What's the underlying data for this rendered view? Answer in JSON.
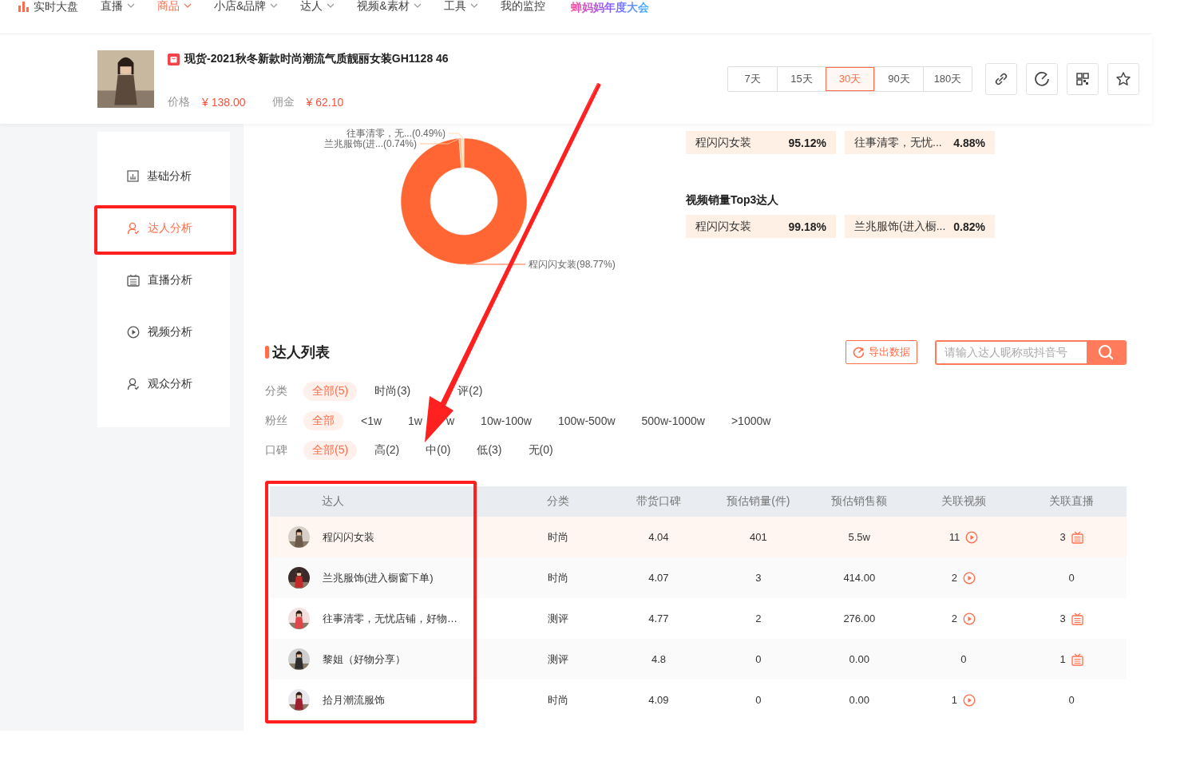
{
  "top_nav": {
    "items": [
      {
        "label": "实时大盘",
        "selected": false,
        "dropdown": false
      },
      {
        "label": "直播",
        "selected": false,
        "dropdown": true
      },
      {
        "label": "商品",
        "selected": true,
        "dropdown": true
      },
      {
        "label": "小店&品牌",
        "selected": false,
        "dropdown": true
      },
      {
        "label": "达人",
        "selected": false,
        "dropdown": true
      },
      {
        "label": "视频&素材",
        "selected": false,
        "dropdown": true
      },
      {
        "label": "工具",
        "selected": false,
        "dropdown": true
      },
      {
        "label": "我的监控",
        "selected": false,
        "dropdown": false
      }
    ],
    "promo": "蝉妈妈年度大会"
  },
  "product": {
    "title": "现货-2021秋冬新款时尚潮流气质靓丽女装GH1128 46",
    "price_label": "价格",
    "price": "¥ 138.00",
    "commission_label": "佣金",
    "commission": "¥ 62.10",
    "ranges": [
      {
        "label": "7天",
        "selected": false
      },
      {
        "label": "15天",
        "selected": false
      },
      {
        "label": "30天",
        "selected": true
      },
      {
        "label": "90天",
        "selected": false
      },
      {
        "label": "180天",
        "selected": false
      }
    ]
  },
  "sidebar": {
    "items": [
      {
        "label": "基础分析",
        "selected": false
      },
      {
        "label": "达人分析",
        "selected": true
      },
      {
        "label": "直播分析",
        "selected": false
      },
      {
        "label": "视频分析",
        "selected": false
      },
      {
        "label": "观众分析",
        "selected": false
      }
    ]
  },
  "share": {
    "chart_data": {
      "type": "donut",
      "categories": [
        "程闪闪女装(98.77%)",
        "兰兆服饰(进...(0.74%)",
        "往事清零，无...(0.49%)"
      ],
      "values": [
        98.77,
        0.74,
        0.49
      ]
    },
    "groups": [
      {
        "items": [
          {
            "name": "程闪闪女装",
            "share": "95.12%"
          },
          {
            "name": "往事清零，无忧...",
            "share": "4.88%"
          }
        ]
      },
      {
        "title": "视频销量Top3达人",
        "items": [
          {
            "name": "程闪闪女装",
            "share": "99.18%"
          },
          {
            "name": "兰兆服饰(进入橱...",
            "share": "0.82%"
          }
        ]
      }
    ]
  },
  "creator_list": {
    "title": "达人列表",
    "export": "导出数据",
    "search": {
      "placeholder": "请输入达人昵称或抖音号"
    },
    "filters": [
      {
        "label": "分类",
        "options": [
          {
            "label": "全部(5)",
            "selected": true,
            "kind": "plain"
          },
          {
            "label": "时尚(3)",
            "selected": false,
            "kind": "plain"
          },
          {
            "label": "评(2)",
            "selected": false,
            "kind": "covered"
          }
        ]
      },
      {
        "label": "粉丝",
        "options": [
          {
            "label": "全部",
            "selected": true,
            "kind": "plain"
          },
          {
            "label": "<1w",
            "selected": false,
            "kind": "plain"
          },
          {
            "label": "1w",
            "tail": "w",
            "selected": false,
            "kind": "split"
          },
          {
            "label": "10w-100w",
            "selected": false,
            "kind": "plain"
          },
          {
            "label": "100w-500w",
            "selected": false,
            "kind": "plain"
          },
          {
            "label": "500w-1000w",
            "selected": false,
            "kind": "plain"
          },
          {
            "label": ">1000w",
            "selected": false,
            "kind": "plain"
          }
        ]
      },
      {
        "label": "口碑",
        "options": [
          {
            "label": "全部(5)",
            "selected": true,
            "kind": "plain"
          },
          {
            "label": "高(2)",
            "selected": false,
            "kind": "plain"
          },
          {
            "label": "中(0)",
            "selected": false,
            "kind": "plain"
          },
          {
            "label": "低(3)",
            "selected": false,
            "kind": "plain"
          },
          {
            "label": "无(0)",
            "selected": false,
            "kind": "plain"
          }
        ]
      }
    ],
    "table": {
      "columns": [
        "达人",
        "分类",
        "带货口碑",
        "预估销量(件)",
        "预估销售额",
        "关联视频",
        "关联直播"
      ],
      "rows": [
        {
          "name": "程闪闪女装",
          "category": "时尚",
          "rating": "4.04",
          "sales": "401",
          "revenue": "5.5w",
          "videos": "11",
          "has_video": true,
          "lives": "3",
          "has_live": true,
          "highlighted": true
        },
        {
          "name": "兰兆服饰(进入橱窗下单)",
          "category": "时尚",
          "rating": "4.07",
          "sales": "3",
          "revenue": "414.00",
          "videos": "2",
          "has_video": true,
          "lives": "0",
          "has_live": false,
          "highlighted": false
        },
        {
          "name": "往事清零，无忧店铺，好物…",
          "category": "测评",
          "rating": "4.77",
          "sales": "2",
          "revenue": "276.00",
          "videos": "2",
          "has_video": true,
          "lives": "3",
          "has_live": true,
          "highlighted": false
        },
        {
          "name": "黎姐（好物分享）",
          "category": "测评",
          "rating": "4.8",
          "sales": "0",
          "revenue": "0.00",
          "videos": "0",
          "has_video": false,
          "lives": "1",
          "has_live": true,
          "highlighted": false
        },
        {
          "name": "拾月潮流服饰",
          "category": "时尚",
          "rating": "4.09",
          "sales": "0",
          "revenue": "0.00",
          "videos": "1",
          "has_video": true,
          "lives": "0",
          "has_live": false,
          "highlighted": false
        }
      ]
    }
  }
}
